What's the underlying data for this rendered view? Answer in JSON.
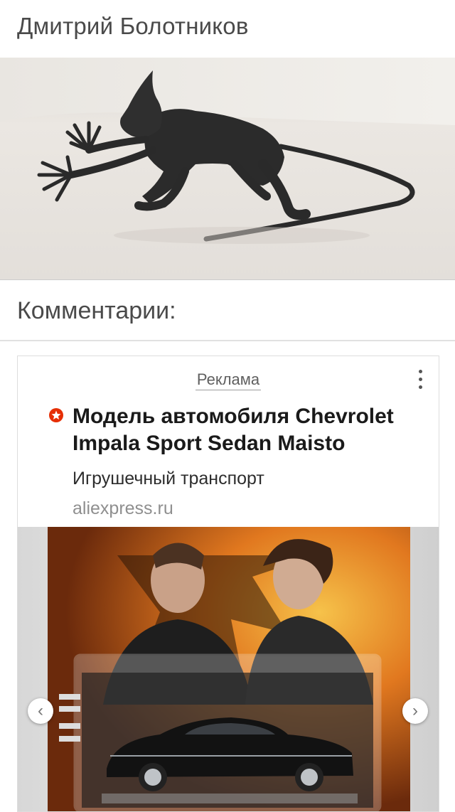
{
  "post": {
    "author_name": "Дмитрий Болотников",
    "image_alt": "статуэтка"
  },
  "comments": {
    "title": "Комментарии:"
  },
  "ad": {
    "label": "Реклама",
    "title": "Модель автомобиля Chevrolet Impala Sport Sedan Maisto",
    "subtitle": "Игрушечный транспорт",
    "domain": "aliexpress.ru",
    "menu_icon": "more-vert-icon",
    "brand_icon": "aliexpress-icon",
    "prev_icon": "chevron-left-icon",
    "next_icon": "chevron-right-icon",
    "prev_glyph": "‹",
    "next_glyph": "›",
    "accent_color": "#e62e04"
  }
}
